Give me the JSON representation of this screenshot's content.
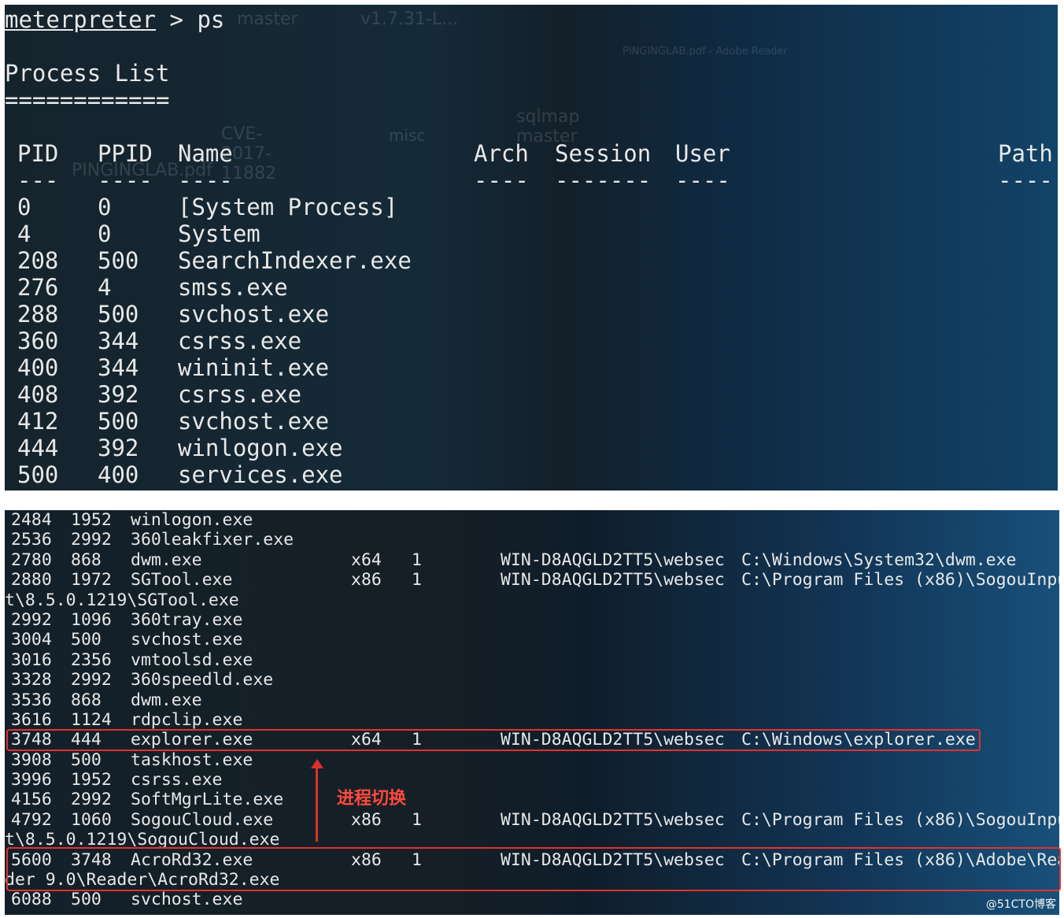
{
  "top": {
    "prompt_label": "meterpreter",
    "prompt_rest": " > ps",
    "heading": "Process List",
    "heading_rule": "============",
    "headers": {
      "pid": "PID",
      "ppid": "PPID",
      "name": "Name",
      "arch": "Arch",
      "session": "Session",
      "user": "User",
      "path": "Path"
    },
    "header_rules": {
      "pid": "---",
      "ppid": "----",
      "name": "----",
      "arch": "----",
      "session": "-------",
      "user": "----",
      "path": "----"
    },
    "rows": [
      {
        "pid": "0",
        "ppid": "0",
        "name": "[System Process]"
      },
      {
        "pid": "4",
        "ppid": "0",
        "name": "System"
      },
      {
        "pid": "208",
        "ppid": "500",
        "name": "SearchIndexer.exe"
      },
      {
        "pid": "276",
        "ppid": "4",
        "name": "smss.exe"
      },
      {
        "pid": "288",
        "ppid": "500",
        "name": "svchost.exe"
      },
      {
        "pid": "360",
        "ppid": "344",
        "name": "csrss.exe"
      },
      {
        "pid": "400",
        "ppid": "344",
        "name": "wininit.exe"
      },
      {
        "pid": "408",
        "ppid": "392",
        "name": "csrss.exe"
      },
      {
        "pid": "412",
        "ppid": "500",
        "name": "svchost.exe"
      },
      {
        "pid": "444",
        "ppid": "392",
        "name": "winlogon.exe"
      },
      {
        "pid": "500",
        "ppid": "400",
        "name": "services.exe"
      }
    ],
    "background_ghost": [
      "master",
      "v1.7.31-L...",
      "CVE-2017-11882",
      "misc",
      "sqlmap master",
      "PINGINGLAB.pdf",
      "PINGINGLAB.pdf - Adobe Reader"
    ]
  },
  "bottom": {
    "lines": [
      {
        "pid": "2484",
        "ppid": "1952",
        "name": "winlogon.exe",
        "arch": "",
        "session": "",
        "user": "",
        "path": ""
      },
      {
        "pid": "2536",
        "ppid": "2992",
        "name": "360leakfixer.exe",
        "arch": "",
        "session": "",
        "user": "",
        "path": ""
      },
      {
        "pid": "2780",
        "ppid": "868",
        "name": "dwm.exe",
        "arch": "x64",
        "session": "1",
        "user": "WIN-D8AQGLD2TT5\\websec",
        "path": "C:\\Windows\\System32\\dwm.exe"
      },
      {
        "pid": "2880",
        "ppid": "1972",
        "name": "SGTool.exe",
        "arch": "x86",
        "session": "1",
        "user": "WIN-D8AQGLD2TT5\\websec",
        "path": "C:\\Program Files (x86)\\SogouInpu"
      },
      {
        "wrap": "t\\8.5.0.1219\\SGTool.exe"
      },
      {
        "pid": "2992",
        "ppid": "1096",
        "name": "360tray.exe",
        "arch": "",
        "session": "",
        "user": "",
        "path": ""
      },
      {
        "pid": "3004",
        "ppid": "500",
        "name": "svchost.exe",
        "arch": "",
        "session": "",
        "user": "",
        "path": ""
      },
      {
        "pid": "3016",
        "ppid": "2356",
        "name": "vmtoolsd.exe",
        "arch": "",
        "session": "",
        "user": "",
        "path": ""
      },
      {
        "pid": "3328",
        "ppid": "2992",
        "name": "360speedld.exe",
        "arch": "",
        "session": "",
        "user": "",
        "path": ""
      },
      {
        "pid": "3536",
        "ppid": "868",
        "name": "dwm.exe",
        "arch": "",
        "session": "",
        "user": "",
        "path": ""
      },
      {
        "pid": "3616",
        "ppid": "1124",
        "name": "rdpclip.exe",
        "arch": "",
        "session": "",
        "user": "",
        "path": ""
      },
      {
        "pid": "3748",
        "ppid": "444",
        "name": "explorer.exe",
        "arch": "x64",
        "session": "1",
        "user": "WIN-D8AQGLD2TT5\\websec",
        "path": "C:\\Windows\\explorer.exe"
      },
      {
        "pid": "3908",
        "ppid": "500",
        "name": "taskhost.exe",
        "arch": "",
        "session": "",
        "user": "",
        "path": ""
      },
      {
        "pid": "3996",
        "ppid": "1952",
        "name": "csrss.exe",
        "arch": "",
        "session": "",
        "user": "",
        "path": ""
      },
      {
        "pid": "4156",
        "ppid": "2992",
        "name": "SoftMgrLite.exe",
        "arch": "",
        "session": "",
        "user": "",
        "path": ""
      },
      {
        "pid": "4792",
        "ppid": "1060",
        "name": "SogouCloud.exe",
        "arch": "x86",
        "session": "1",
        "user": "WIN-D8AQGLD2TT5\\websec",
        "path": "C:\\Program Files (x86)\\SogouInpu"
      },
      {
        "wrap": "t\\8.5.0.1219\\SogouCloud.exe"
      },
      {
        "pid": "5600",
        "ppid": "3748",
        "name": "AcroRd32.exe",
        "arch": "x86",
        "session": "1",
        "user": "WIN-D8AQGLD2TT5\\websec",
        "path": "C:\\Program Files (x86)\\Adobe\\Rea"
      },
      {
        "wrap": "der 9.0\\Reader\\AcroRd32.exe"
      },
      {
        "pid": "6088",
        "ppid": "500",
        "name": "svchost.exe",
        "arch": "",
        "session": "",
        "user": "",
        "path": ""
      }
    ]
  },
  "annotation": {
    "text": "进程切换",
    "color": "#e0332e"
  },
  "watermark": "@51CTO博客"
}
